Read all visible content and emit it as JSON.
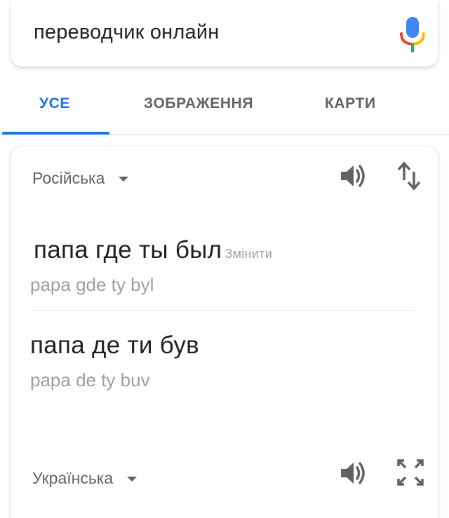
{
  "search": {
    "query": "переводчик онлайн",
    "mic_icon": "microphone-icon"
  },
  "tabs": [
    {
      "label": "УСЕ",
      "active": true
    },
    {
      "label": "ЗОБРАЖЕННЯ",
      "active": false
    },
    {
      "label": "КАРТИ",
      "active": false
    }
  ],
  "translate": {
    "source_language": "Російська",
    "source_text": "папа где ты был",
    "change_label": "Змінити",
    "source_transliteration": "papa gde ty byl",
    "target_text": "папа де ти був",
    "target_transliteration": "papa de ty buv",
    "target_language": "Українська",
    "icons": {
      "source_speaker": "speaker-icon",
      "swap": "swap-languages-icon",
      "target_speaker": "speaker-icon",
      "fullscreen": "fullscreen-icon"
    }
  },
  "colors": {
    "accent": "#1a73e8",
    "text_primary": "#202124",
    "text_secondary": "#5f6368",
    "text_muted": "#9aa0a6",
    "mic_blue": "#4285f4",
    "mic_red": "#ea4335",
    "mic_yellow": "#fbbc05",
    "mic_green": "#34a853"
  }
}
